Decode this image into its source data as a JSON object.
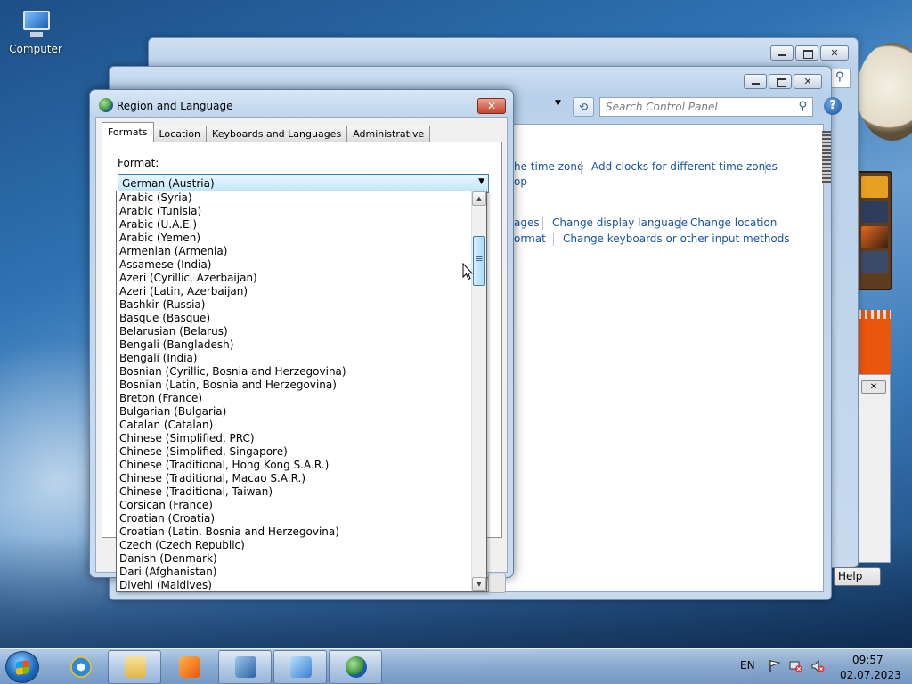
{
  "desktop": {
    "computer_icon_label": "Computer"
  },
  "control_panel": {
    "search_placeholder": "Search Control Panel",
    "links": {
      "time_zone": "he time zone",
      "add_clocks": "Add clocks for different time zones",
      "op": "op",
      "ages": "ages",
      "change_display_language": "Change display language",
      "change_location": "Change location",
      "format": "ormat",
      "change_keyboards": "Change keyboards or other input methods"
    },
    "help_button": "Help"
  },
  "dialog": {
    "title": "Region and Language",
    "tabs": [
      "Formats",
      "Location",
      "Keyboards and Languages",
      "Administrative"
    ],
    "format_label": "Format:",
    "selected_format": "German (Austria)",
    "format_options": [
      "Arabic (Syria)",
      "Arabic (Tunisia)",
      "Arabic (U.A.E.)",
      "Arabic (Yemen)",
      "Armenian (Armenia)",
      "Assamese (India)",
      "Azeri (Cyrillic, Azerbaijan)",
      "Azeri (Latin, Azerbaijan)",
      "Bashkir (Russia)",
      "Basque (Basque)",
      "Belarusian (Belarus)",
      "Bengali (Bangladesh)",
      "Bengali (India)",
      "Bosnian (Cyrillic, Bosnia and Herzegovina)",
      "Bosnian (Latin, Bosnia and Herzegovina)",
      "Breton (France)",
      "Bulgarian (Bulgaria)",
      "Catalan (Catalan)",
      "Chinese (Simplified, PRC)",
      "Chinese (Simplified, Singapore)",
      "Chinese (Traditional, Hong Kong S.A.R.)",
      "Chinese (Traditional, Macao S.A.R.)",
      "Chinese (Traditional, Taiwan)",
      "Corsican (France)",
      "Croatian (Croatia)",
      "Croatian (Latin, Bosnia and Herzegovina)",
      "Czech (Czech Republic)",
      "Danish (Denmark)",
      "Dari (Afghanistan)",
      "Divehi (Maldives)"
    ]
  },
  "taskbar": {
    "language": "EN",
    "time": "09:57",
    "date": "02.07.2023"
  },
  "colors": {
    "link": "#1a55a0",
    "dropdown_highlight": "#bee6fd"
  }
}
